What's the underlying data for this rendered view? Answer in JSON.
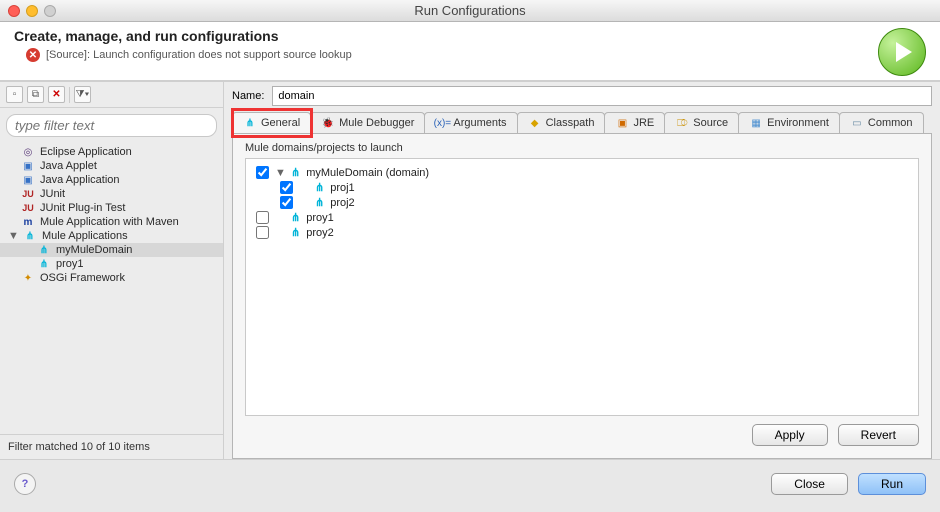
{
  "window": {
    "title": "Run Configurations"
  },
  "header": {
    "title": "Create, manage, and run configurations",
    "error": "[Source]: Launch configuration does not support source lookup"
  },
  "left": {
    "filter_placeholder": "type filter text",
    "items": [
      {
        "label": "Eclipse Application"
      },
      {
        "label": "Java Applet"
      },
      {
        "label": "Java Application"
      },
      {
        "label": "JUnit"
      },
      {
        "label": "JUnit Plug-in Test"
      },
      {
        "label": "Mule Application with Maven"
      },
      {
        "label": "Mule Applications"
      },
      {
        "label": "myMuleDomain"
      },
      {
        "label": "proy1"
      },
      {
        "label": "OSGi Framework"
      }
    ],
    "status": "Filter matched 10 of 10 items"
  },
  "right": {
    "name_label": "Name:",
    "name_value": "domain",
    "tabs": [
      {
        "label": "General"
      },
      {
        "label": "Mule Debugger"
      },
      {
        "label": "Arguments"
      },
      {
        "label": "Classpath"
      },
      {
        "label": "JRE"
      },
      {
        "label": "Source"
      },
      {
        "label": "Environment"
      },
      {
        "label": "Common"
      }
    ],
    "panel_label": "Mule domains/projects to launch",
    "launch_items": [
      {
        "label": "myMuleDomain (domain)",
        "checked": true,
        "indent": 0
      },
      {
        "label": "proj1",
        "checked": true,
        "indent": 1
      },
      {
        "label": "proj2",
        "checked": true,
        "indent": 1
      },
      {
        "label": "proy1",
        "checked": false,
        "indent": 0
      },
      {
        "label": "proy2",
        "checked": false,
        "indent": 0
      }
    ],
    "apply": "Apply",
    "revert": "Revert"
  },
  "footer": {
    "close": "Close",
    "run": "Run"
  }
}
